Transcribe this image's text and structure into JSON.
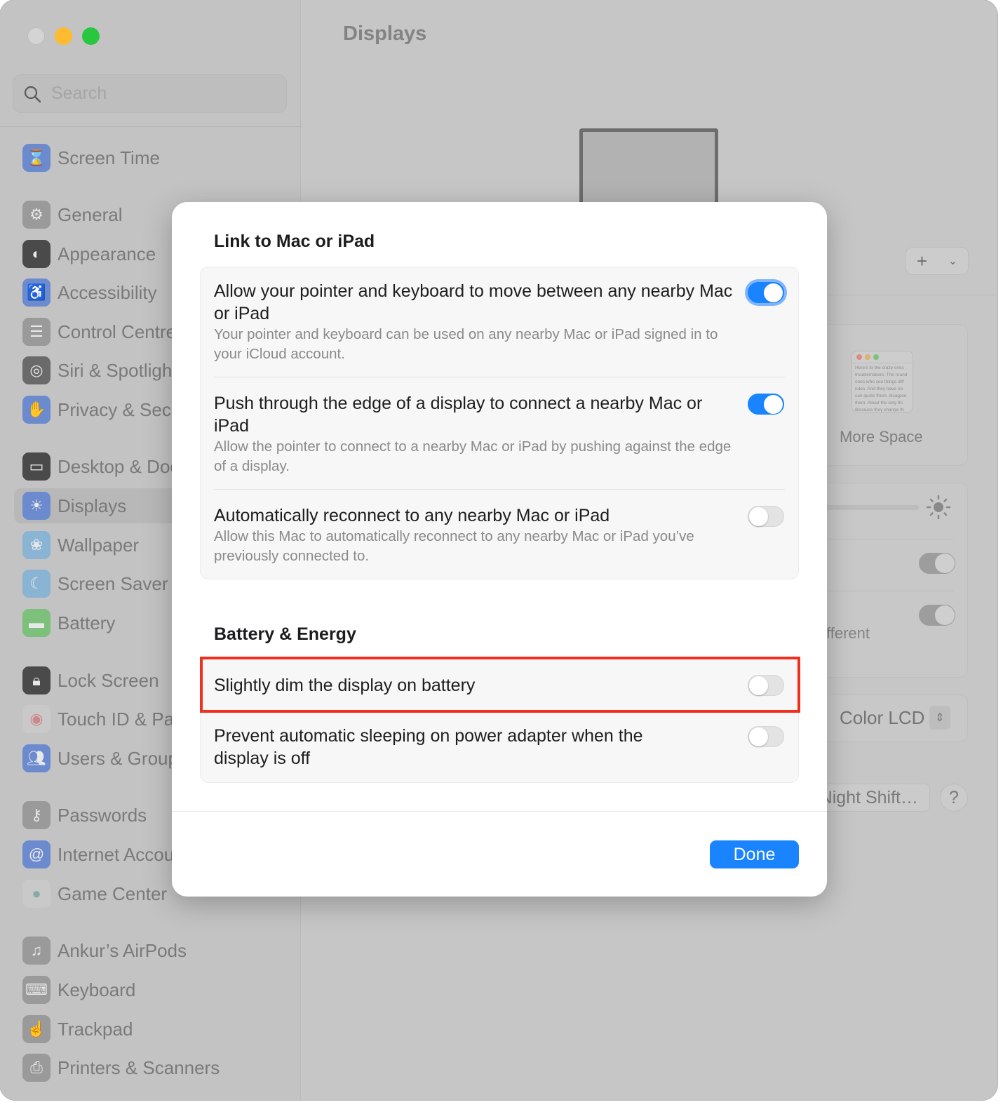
{
  "window": {
    "controls": [
      "close",
      "minimize",
      "maximize"
    ]
  },
  "sidebar": {
    "search_placeholder": "Search",
    "selected": "Displays",
    "items": [
      {
        "label": "Screen Time",
        "icon": "hourglass-icon",
        "color": "#6c8bcf"
      },
      {
        "label": "General",
        "icon": "gear-icon",
        "color": "#9a9a9a"
      },
      {
        "label": "Appearance",
        "icon": "appearance-icon",
        "color": "#4a4a4a"
      },
      {
        "label": "Accessibility",
        "icon": "accessibility-icon",
        "color": "#6c8bcf"
      },
      {
        "label": "Control Centre",
        "icon": "control-centre-icon",
        "color": "#9a9a9a"
      },
      {
        "label": "Siri & Spotlight",
        "icon": "siri-icon",
        "color": "#6a6a6a"
      },
      {
        "label": "Privacy & Security",
        "icon": "hand-icon",
        "color": "#6c8bcf"
      },
      {
        "label": "Desktop & Dock",
        "icon": "dock-icon",
        "color": "#4a4a4a"
      },
      {
        "label": "Displays",
        "icon": "sun-icon",
        "color": "#6c8bcf"
      },
      {
        "label": "Wallpaper",
        "icon": "flower-icon",
        "color": "#8ab4d4"
      },
      {
        "label": "Screen Saver",
        "icon": "screen-saver-icon",
        "color": "#8ab4d4"
      },
      {
        "label": "Battery",
        "icon": "battery-icon",
        "color": "#7cc07c"
      },
      {
        "label": "Lock Screen",
        "icon": "lock-icon",
        "color": "#4a4a4a"
      },
      {
        "label": "Touch ID & Password",
        "icon": "fingerprint-icon",
        "color": "#c9c9c9"
      },
      {
        "label": "Users & Groups",
        "icon": "users-icon",
        "color": "#6c8bcf"
      },
      {
        "label": "Passwords",
        "icon": "key-icon",
        "color": "#9a9a9a"
      },
      {
        "label": "Internet Accounts",
        "icon": "at-icon",
        "color": "#6c8bcf"
      },
      {
        "label": "Game Center",
        "icon": "game-center-icon",
        "color": "#c9c9c9"
      },
      {
        "label": "Ankur’s AirPods",
        "icon": "airpods-icon",
        "color": "#9a9a9a"
      },
      {
        "label": "Keyboard",
        "icon": "keyboard-icon",
        "color": "#9a9a9a"
      },
      {
        "label": "Trackpad",
        "icon": "trackpad-icon",
        "color": "#9a9a9a"
      },
      {
        "label": "Printers & Scanners",
        "icon": "printer-icon",
        "color": "#9a9a9a"
      }
    ]
  },
  "main": {
    "title": "Displays",
    "more_space_label": "More Space",
    "mini_window_text": [
      "Here's to the crazy ones",
      "troublemakers. The round",
      "ones who see things diff",
      "rules. And they have no",
      "can quote them, disagree",
      "them. About the only thi",
      "Because they change th"
    ],
    "different_text": "fferent",
    "color_profile": "Color LCD",
    "night_shift_label": "Night Shift…",
    "help_label": "?",
    "add_label": "+"
  },
  "modal": {
    "sections": [
      {
        "title": "Link to Mac or iPad",
        "rows": [
          {
            "title": "Allow your pointer and keyboard to move between any nearby Mac or iPad",
            "description": "Your pointer and keyboard can be used on any nearby Mac or iPad signed in to your iCloud account.",
            "enabled": true
          },
          {
            "title": "Push through the edge of a display to connect a nearby Mac or iPad",
            "description": "Allow the pointer to connect to a nearby Mac or iPad by pushing against the edge of a display.",
            "enabled": true
          },
          {
            "title": "Automatically reconnect to any nearby Mac or iPad",
            "description": "Allow this Mac to automatically reconnect to any nearby Mac or iPad you’ve previously connected to.",
            "enabled": false
          }
        ]
      },
      {
        "title": "Battery & Energy",
        "rows": [
          {
            "title": "Slightly dim the display on battery",
            "enabled": false,
            "highlighted": true
          },
          {
            "title": "Prevent automatic sleeping on power adapter when the display is off",
            "enabled": false
          }
        ]
      }
    ],
    "done_label": "Done",
    "accent_color": "#1a84ff",
    "highlight_color": "#f0301f"
  }
}
